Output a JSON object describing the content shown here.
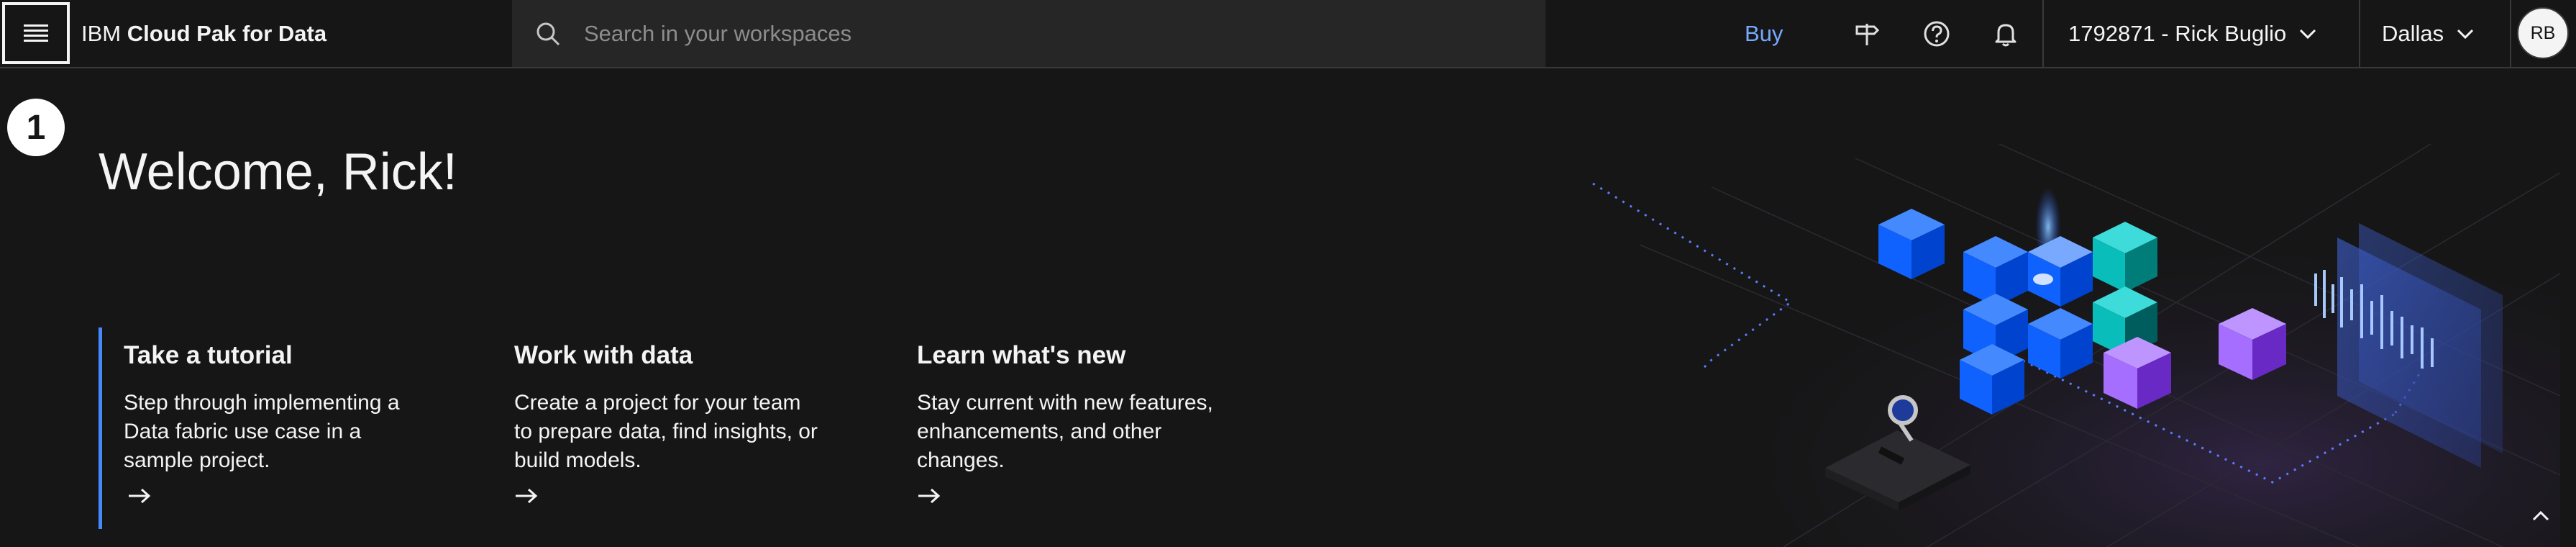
{
  "header": {
    "product_prefix": "IBM",
    "product_name": "Cloud Pak for Data",
    "search_placeholder": "Search in your workspaces",
    "buy_label": "Buy",
    "account_label": "1792871 - Rick Buglio",
    "region_label": "Dallas",
    "avatar_initials": "RB",
    "icons": [
      "menu-icon",
      "search-icon",
      "signpost-icon",
      "help-icon",
      "notification-icon",
      "chevron-down-icon"
    ]
  },
  "main": {
    "step_badge": "1",
    "welcome": "Welcome, Rick!",
    "cards": [
      {
        "title": "Take a tutorial",
        "lines": [
          "Step through implementing a",
          "Data fabric use case in a",
          "sample project."
        ]
      },
      {
        "title": "Work with data",
        "lines": [
          "Create a project for your team",
          "to prepare data, find insights, or",
          "build models."
        ]
      },
      {
        "title": "Learn what's new",
        "lines": [
          "Stay current with new features,",
          "enhancements, and other",
          "changes."
        ]
      }
    ]
  },
  "colors": {
    "background": "#161616",
    "search_bg": "#262626",
    "link": "#78a9ff",
    "accent_border": "#4589ff",
    "text": "#f4f4f4"
  }
}
